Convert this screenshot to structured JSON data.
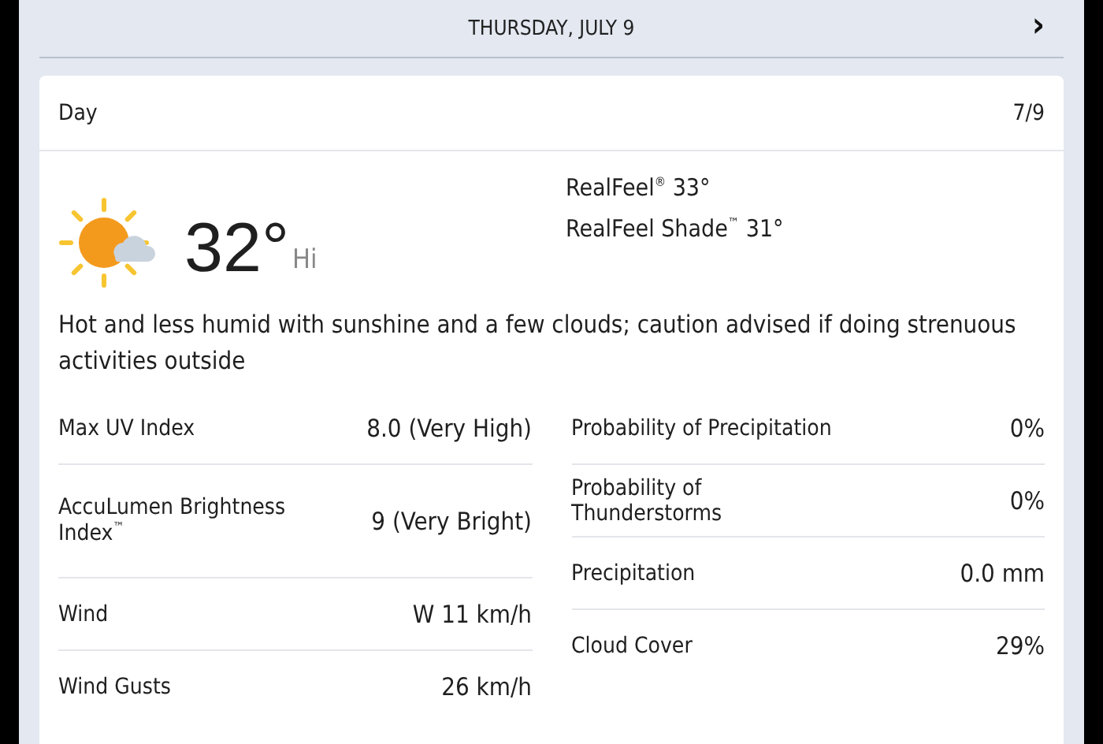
{
  "header": {
    "date": "THURSDAY, JULY 9",
    "next": "›"
  },
  "card": {
    "title": "Day",
    "date": "7/9",
    "temperature": "32°",
    "temp_label": "Hi",
    "realfeel": [
      "RealFeel$^{®}$ 33°",
      "RealFeel Shade$^{™}$ 31°"
    ],
    "description": "Hot and less humid with sunshine and a few clouds; caution advised if doing strenuous activities outside",
    "left_details": [
      {
        "label": "Max UV Index",
        "value": "8.0 (Very High)"
      },
      {
        "label": "AccuLumen Brightness Index$^{™}$",
        "value": "9 (Very Bright)"
      },
      {
        "label": "Wind",
        "value": "W 11 km/h"
      },
      {
        "label": "Wind Gusts",
        "value": "26 km/h"
      }
    ],
    "right_details": [
      {
        "label": "Probability of Precipitation",
        "value": "0%"
      },
      {
        "label": "Probability of Thunderstorms",
        "value": "0%"
      },
      {
        "label": "Precipitation",
        "value": "0.0 mm"
      },
      {
        "label": "Cloud Cover",
        "value": "29%"
      }
    ]
  }
}
